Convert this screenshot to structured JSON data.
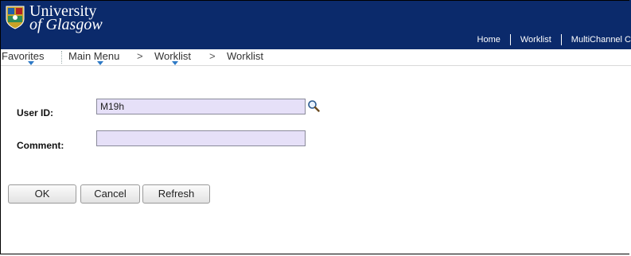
{
  "header": {
    "logo_line1": "University",
    "logo_line2": "of Glasgow",
    "nav": [
      "Home",
      "Worklist",
      "MultiChannel C"
    ],
    "brand_color": "#0b2a6b"
  },
  "menubar": {
    "favorites": "Favorites",
    "main_menu": "Main Menu",
    "crumb_sep": ">",
    "crumb1": "Worklist",
    "crumb2": "Worklist"
  },
  "form": {
    "userid_label": "User ID:",
    "userid_value": "M19h",
    "comment_label": "Comment:",
    "comment_value": "",
    "field_color": "#e6e0f8"
  },
  "buttons": {
    "ok": "OK",
    "cancel": "Cancel",
    "refresh": "Refresh"
  }
}
